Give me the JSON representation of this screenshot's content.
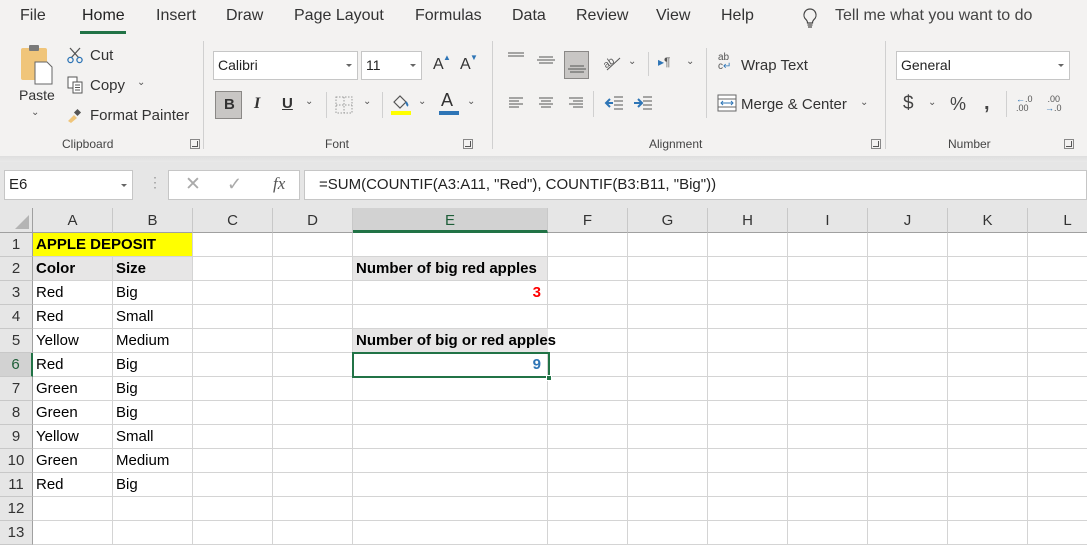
{
  "menu": {
    "tabs": [
      "File",
      "Home",
      "Insert",
      "Draw",
      "Page Layout",
      "Formulas",
      "Data",
      "Review",
      "View",
      "Help"
    ],
    "active_tab": "Home",
    "tell_me": "Tell me what you want to do"
  },
  "ribbon": {
    "clipboard": {
      "paste": "Paste",
      "cut": "Cut",
      "copy": "Copy",
      "format_painter": "Format Painter",
      "label": "Clipboard"
    },
    "font": {
      "font_name": "Calibri",
      "font_size": "11",
      "bold": "B",
      "italic": "I",
      "underline": "U",
      "font_color_letter": "A",
      "increase_size": "A",
      "decrease_size": "A",
      "label": "Font",
      "fill_color": "#ffff00",
      "font_color": "#2e75b6"
    },
    "alignment": {
      "wrap_text": "Wrap Text",
      "merge_center": "Merge & Center",
      "label": "Alignment"
    },
    "number": {
      "format": "General",
      "currency": "$",
      "percent": "%",
      "comma": ",",
      "label": "Number"
    }
  },
  "formula_bar": {
    "name_box": "E6",
    "fx": "fx",
    "formula": "=SUM(COUNTIF(A3:A11, \"Red\"), COUNTIF(B3:B11, \"Big\"))"
  },
  "sheet": {
    "columns": [
      "A",
      "B",
      "C",
      "D",
      "E",
      "F",
      "G",
      "H",
      "I",
      "J",
      "K",
      "L"
    ],
    "rows": [
      "1",
      "2",
      "3",
      "4",
      "5",
      "6",
      "7",
      "8",
      "9",
      "10",
      "11",
      "12",
      "13"
    ],
    "selected_cell": "E6",
    "title": "APPLE DEPOSIT",
    "headers": [
      "Color",
      "Size"
    ],
    "data": [
      [
        "Red",
        "Big"
      ],
      [
        "Red",
        "Small"
      ],
      [
        "Yellow",
        "Medium"
      ],
      [
        "Red",
        "Big"
      ],
      [
        "Green",
        "Big"
      ],
      [
        "Green",
        "Big"
      ],
      [
        "Yellow",
        "Small"
      ],
      [
        "Green",
        "Medium"
      ],
      [
        "Red",
        "Big"
      ]
    ],
    "summary": {
      "label1": "Number of big red apples",
      "value1": "3",
      "label2": "Number of big or red apples",
      "value2": "9"
    },
    "colors": {
      "title_fill": "#ffff00",
      "header_fill": "#e7e6e6",
      "value1_color": "#ff0000",
      "value2_color": "#2e75b6",
      "accent": "#217346"
    }
  }
}
